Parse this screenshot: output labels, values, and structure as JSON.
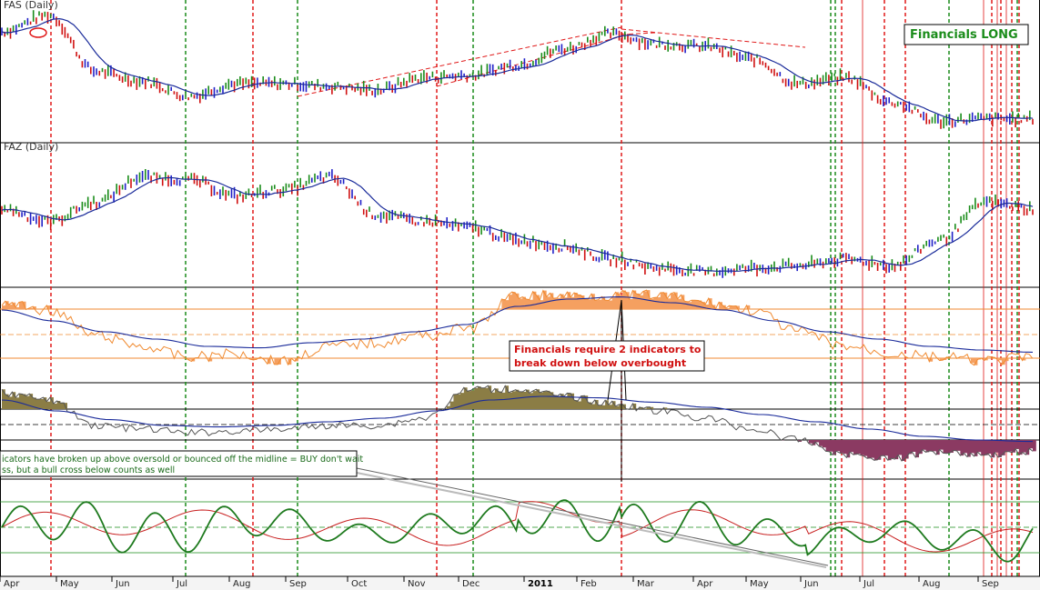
{
  "chart_data": [
    {
      "type": "line",
      "title": "FAS (Daily)",
      "style": "colored price bars with moving average",
      "bar_colors": {
        "up": "#1e9c1e",
        "down": "#e0102a",
        "neutral": "#2020c8"
      },
      "ma_color": "#1a2b9a",
      "x": [
        "Apr",
        "May",
        "Jun",
        "Jul",
        "Aug",
        "Sep",
        "Oct",
        "Nov",
        "Dec",
        "2011",
        "Feb",
        "Mar",
        "Apr",
        "May",
        "Jun",
        "Jul",
        "Aug",
        "Sep"
      ],
      "close_trace": [
        0.82,
        0.95,
        0.5,
        0.42,
        0.3,
        0.4,
        0.4,
        0.38,
        0.35,
        0.45,
        0.47,
        0.55,
        0.68,
        0.8,
        0.72,
        0.7,
        0.6,
        0.4,
        0.45,
        0.25,
        0.1,
        0.12,
        0.12
      ],
      "annotation": "Financials LONG"
    },
    {
      "type": "line",
      "title": "FAZ (Daily)",
      "style": "colored price bars with moving average",
      "close_trace": [
        0.55,
        0.45,
        0.6,
        0.8,
        0.78,
        0.65,
        0.7,
        0.8,
        0.5,
        0.45,
        0.4,
        0.3,
        0.25,
        0.15,
        0.08,
        0.05,
        0.08,
        0.1,
        0.15,
        0.1,
        0.3,
        0.6,
        0.55
      ]
    },
    {
      "type": "area",
      "title": "",
      "color": "#f08a30",
      "overbought_level": "upper orange line",
      "oversold_level": "lower orange line",
      "annotation": "Financials require 2 indicators to break down below overbought"
    },
    {
      "type": "area",
      "title": "",
      "above_color": "#8b7d45",
      "below_color": "#8b3a62"
    },
    {
      "type": "line",
      "title": "",
      "series": [
        {
          "color": "#1e7a1e"
        },
        {
          "color": "#c82020"
        }
      ],
      "annotation": "...cators have broken up above oversold or bounced off the midline = BUY don't wait ...ss, but a bull cross below counts as well"
    }
  ],
  "x_axis": {
    "labels": [
      "Apr",
      "May",
      "Jun",
      "Jul",
      "Aug",
      "Sep",
      "Oct",
      "Nov",
      "Dec",
      "2011",
      "Feb",
      "Mar",
      "Apr",
      "May",
      "Jun",
      "Jul",
      "Aug",
      "Sep"
    ],
    "bold_label": "2011"
  },
  "colors": {
    "sell_line": "#e01818",
    "buy_line": "#1a8c1a",
    "callout_border": "#000000",
    "green_box_text": "#1a8c1a",
    "red_box_text": "#d01010"
  },
  "labels": {
    "fas_title": "FAS (Daily)",
    "faz_title": "FAZ (Daily)",
    "financials_long": "Financials LONG",
    "callout_1_line1": "Financials require 2 indicators to",
    "callout_1_line2": "break down below overbought",
    "callout_2_line1": "icators have broken up above oversold or bounced off the midline = BUY don't wait",
    "callout_2_line2": "ss, but a bull cross below counts as well"
  }
}
